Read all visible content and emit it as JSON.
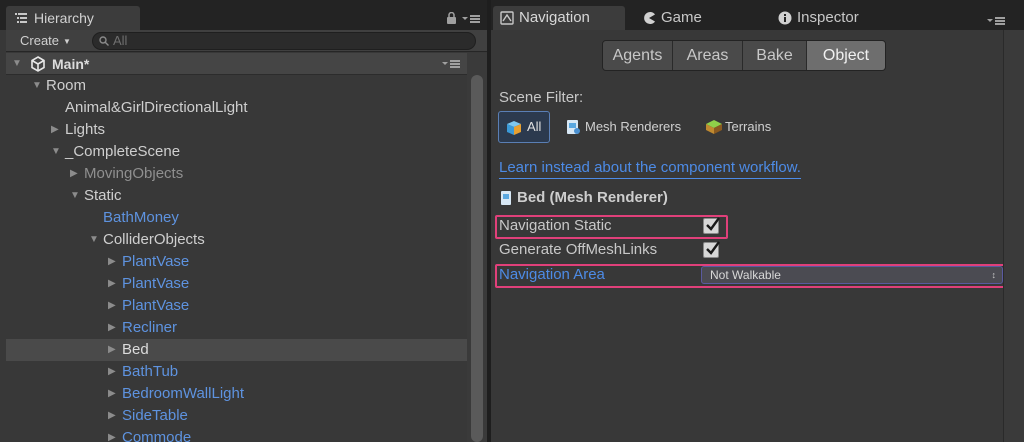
{
  "hierarchy": {
    "tab_label": "Hierarchy",
    "create_label": "Create",
    "search_placeholder": "All",
    "scene_name": "Main*",
    "items": [
      {
        "label": "Room",
        "depth": 0,
        "expand": "open",
        "color": "white"
      },
      {
        "label": "Animal&GirlDirectionalLight",
        "depth": 1,
        "expand": "none",
        "color": "white"
      },
      {
        "label": "Lights",
        "depth": 1,
        "expand": "closed",
        "color": "white"
      },
      {
        "label": "_CompleteScene",
        "depth": 1,
        "expand": "open",
        "color": "white"
      },
      {
        "label": "MovingObjects",
        "depth": 2,
        "expand": "closed",
        "color": "gray"
      },
      {
        "label": "Static",
        "depth": 2,
        "expand": "open",
        "color": "white"
      },
      {
        "label": "BathMoney",
        "depth": 3,
        "expand": "none",
        "color": "blue"
      },
      {
        "label": "ColliderObjects",
        "depth": 3,
        "expand": "open",
        "color": "white"
      },
      {
        "label": "PlantVase",
        "depth": 4,
        "expand": "closed",
        "color": "blue"
      },
      {
        "label": "PlantVase",
        "depth": 4,
        "expand": "closed",
        "color": "blue"
      },
      {
        "label": "PlantVase",
        "depth": 4,
        "expand": "closed",
        "color": "blue"
      },
      {
        "label": "Recliner",
        "depth": 4,
        "expand": "closed",
        "color": "blue"
      },
      {
        "label": "Bed",
        "depth": 4,
        "expand": "closed",
        "color": "bright",
        "selected": true
      },
      {
        "label": "BathTub",
        "depth": 4,
        "expand": "closed",
        "color": "blue"
      },
      {
        "label": "BedroomWallLight",
        "depth": 4,
        "expand": "closed",
        "color": "blue"
      },
      {
        "label": "SideTable",
        "depth": 4,
        "expand": "closed",
        "color": "blue"
      },
      {
        "label": "Commode",
        "depth": 4,
        "expand": "closed",
        "color": "blue"
      }
    ]
  },
  "tabs": {
    "navigation": "Navigation",
    "game": "Game",
    "inspector": "Inspector"
  },
  "navigation": {
    "segments": [
      "Agents",
      "Areas",
      "Bake",
      "Object"
    ],
    "active_segment": "Object",
    "scene_filter_label": "Scene Filter:",
    "filters": {
      "all": "All",
      "mesh_renderers": "Mesh Renderers",
      "terrains": "Terrains"
    },
    "learn_link": "Learn instead about the component workflow.",
    "object_title": "Bed (Mesh Renderer)",
    "navigation_static_label": "Navigation Static",
    "navigation_static_checked": true,
    "generate_offmesh_label": "Generate OffMeshLinks",
    "generate_offmesh_checked": true,
    "navigation_area_label": "Navigation Area",
    "navigation_area_value": "Not Walkable"
  },
  "colors": {
    "highlight": "#e0407a",
    "link_blue": "#4d8be6",
    "prefab_blue": "#5e93e0"
  }
}
